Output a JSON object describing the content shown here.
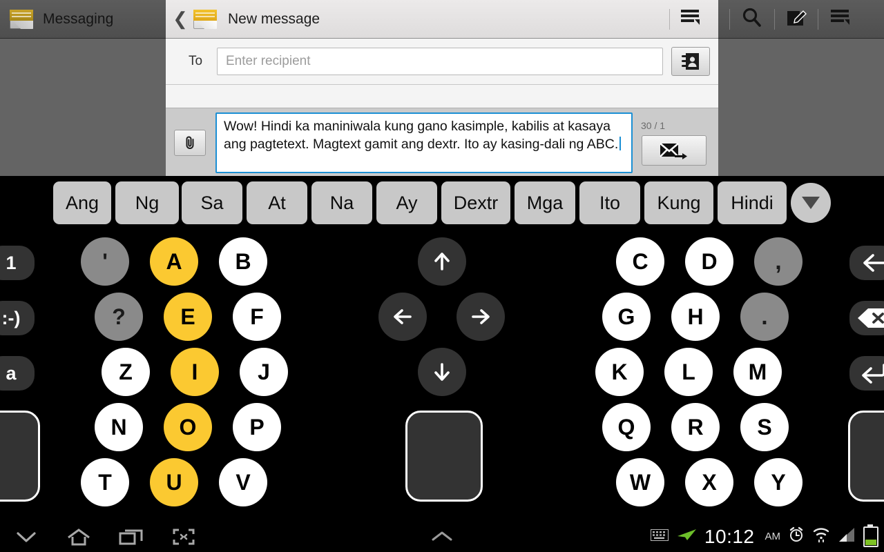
{
  "topbar": {
    "app_title": "Messaging",
    "app_icon": "envelope-icon",
    "screen_title": "New message",
    "screen_icon": "envelope-icon",
    "back_icon": "back-chevron-icon",
    "menu_icon": "menu-icon",
    "search_icon": "search-icon",
    "compose_icon": "compose-icon",
    "overflow_icon": "menu-icon"
  },
  "compose": {
    "to_label": "To",
    "recipient_value": "",
    "recipient_placeholder": "Enter recipient",
    "contacts_button_icon": "contacts-book-icon",
    "attach_button_icon": "paperclip-icon",
    "message_text": "Wow! Hindi ka maniniwala kung gano kasimple, kabilis at kasaya ang pagtetext. Magtext gamit ang dextr. Ito ay kasing-dali ng ABC.",
    "counter": "30 / 1",
    "send_button_icon": "send-message-icon"
  },
  "keyboard": {
    "suggestions": [
      "Ang",
      "Ng",
      "Sa",
      "At",
      "Na",
      "Ay",
      "Dextr",
      "Mga",
      "Ito",
      "Kung",
      "Hindi"
    ],
    "more_suggestions_icon": "chevron-down-icon",
    "left_edge_keys": [
      {
        "label": "1",
        "name": "numbers-key"
      },
      {
        "label": ":-)",
        "name": "emoticon-key"
      },
      {
        "label": "a",
        "name": "lowercase-key"
      },
      {
        "label": "",
        "name": "left-blank-key"
      }
    ],
    "col_punct_left": [
      "'",
      "?"
    ],
    "col_letters_1": [
      "Z",
      "N",
      "T"
    ],
    "col_vowels": [
      "A",
      "E",
      "I",
      "O",
      "U"
    ],
    "col_letters_2": [
      "B",
      "F",
      "J",
      "P",
      "V"
    ],
    "col_letters_3": [
      "C",
      "G",
      "K",
      "Q",
      "W"
    ],
    "col_letters_4": [
      "D",
      "H",
      "L",
      "R",
      "X"
    ],
    "col_punct_right": [
      ",",
      "."
    ],
    "col_letters_5": [
      "M",
      "S",
      "Y"
    ],
    "arrows": [
      "up-arrow-key",
      "left-arrow-key",
      "right-arrow-key",
      "down-arrow-key"
    ],
    "space_key_name": "space-key",
    "right_edge_keys": [
      {
        "name": "back-arrow-key"
      },
      {
        "name": "backspace-key"
      },
      {
        "name": "enter-key"
      },
      {
        "name": "right-blank-key"
      }
    ],
    "accent_color": "#fbc931"
  },
  "navbar": {
    "hide_keyboard_icon": "chevron-down-icon",
    "home_icon": "home-icon",
    "recents_icon": "recents-icon",
    "screenshot_icon": "screen-capture-icon",
    "expand_icon": "chevron-up-icon"
  },
  "statusbar": {
    "keyboard_icon": "keyboard-icon",
    "location_icon": "location-arrow-icon",
    "time": "10:12",
    "meridiem": "AM",
    "alarm_icon": "alarm-clock-icon",
    "wifi_icon": "wifi-icon",
    "signal_icon": "signal-bars-icon",
    "battery_icon": "battery-icon"
  }
}
